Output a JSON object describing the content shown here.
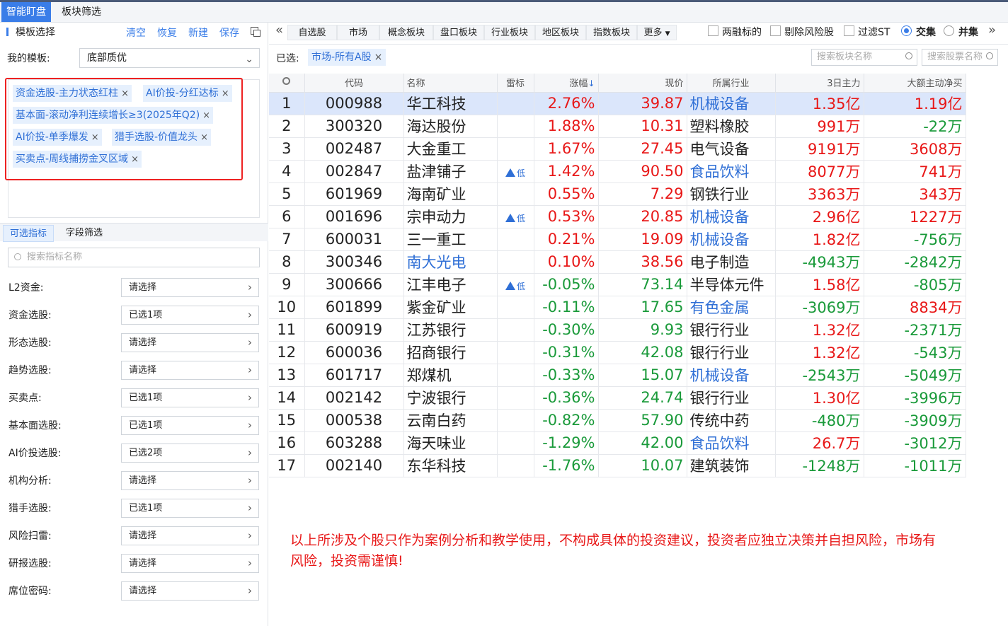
{
  "topbar": {
    "tabs": [
      "智能盯盘",
      "板块筛选"
    ]
  },
  "left": {
    "title": "模板选择",
    "actions": [
      "清空",
      "恢复",
      "新建",
      "保存"
    ],
    "my_template_label": "我的模板:",
    "my_template_value": "底部质优",
    "tags": [
      "资金选股-主力状态红柱",
      "AI价投-分红达标",
      "基本面-滚动净利连续增长≥3(2025年Q2)",
      "AI价投-单季爆发",
      "猎手选股-价值龙头",
      "买卖点-周线捕捞金叉区域"
    ],
    "subtabs": [
      "可选指标",
      "字段筛选"
    ],
    "search_placeholder": "搜索指标名称",
    "filters": [
      {
        "label": "L2资金:",
        "value": "请选择"
      },
      {
        "label": "资金选股:",
        "value": "已选1项"
      },
      {
        "label": "形态选股:",
        "value": "请选择"
      },
      {
        "label": "趋势选股:",
        "value": "请选择"
      },
      {
        "label": "买卖点:",
        "value": "已选1项"
      },
      {
        "label": "基本面选股:",
        "value": "已选1项"
      },
      {
        "label": "AI价投选股:",
        "value": "已选2项"
      },
      {
        "label": "机构分析:",
        "value": "请选择"
      },
      {
        "label": "猎手选股:",
        "value": "已选1项"
      },
      {
        "label": "风险扫雷:",
        "value": "请选择"
      },
      {
        "label": "研报选股:",
        "value": "请选择"
      },
      {
        "label": "席位密码:",
        "value": "请选择"
      }
    ]
  },
  "right": {
    "nav": [
      "自选股",
      "市场",
      "概念板块",
      "盘口板块",
      "行业板块",
      "地区板块",
      "指数板块",
      "更多"
    ],
    "options": [
      "两融标的",
      "剔除风险股",
      "过滤ST"
    ],
    "radios": [
      "交集",
      "并集"
    ],
    "selected_label": "已选:",
    "selected_chip": "市场-所有A股",
    "search_sector_placeholder": "搜索板块名称",
    "search_stock_placeholder": "搜索股票名称",
    "columns": [
      "代码",
      "名称",
      "雷标",
      "涨幅",
      "现价",
      "所属行业",
      "3日主力",
      "大额主动净买"
    ],
    "risk_label": "低",
    "rows": [
      {
        "n": "1",
        "code": "000988",
        "name": "华工科技",
        "risk": false,
        "chg": "2.76%",
        "price": "39.87",
        "ind": "机械设备",
        "indBlue": true,
        "nameBlue": false,
        "m3": "1.35亿",
        "big": "1.19亿"
      },
      {
        "n": "2",
        "code": "300320",
        "name": "海达股份",
        "risk": false,
        "chg": "1.88%",
        "price": "10.31",
        "ind": "塑料橡胶",
        "indBlue": false,
        "nameBlue": false,
        "m3": "991万",
        "big": "-22万"
      },
      {
        "n": "3",
        "code": "002487",
        "name": "大金重工",
        "risk": false,
        "chg": "1.67%",
        "price": "27.45",
        "ind": "电气设备",
        "indBlue": false,
        "nameBlue": false,
        "m3": "9191万",
        "big": "3608万"
      },
      {
        "n": "4",
        "code": "002847",
        "name": "盐津铺子",
        "risk": true,
        "chg": "1.42%",
        "price": "90.50",
        "ind": "食品饮料",
        "indBlue": true,
        "nameBlue": false,
        "m3": "8077万",
        "big": "741万"
      },
      {
        "n": "5",
        "code": "601969",
        "name": "海南矿业",
        "risk": false,
        "chg": "0.55%",
        "price": "7.29",
        "ind": "钢铁行业",
        "indBlue": false,
        "nameBlue": false,
        "m3": "3363万",
        "big": "343万"
      },
      {
        "n": "6",
        "code": "001696",
        "name": "宗申动力",
        "risk": true,
        "chg": "0.53%",
        "price": "20.85",
        "ind": "机械设备",
        "indBlue": true,
        "nameBlue": false,
        "m3": "2.96亿",
        "big": "1227万"
      },
      {
        "n": "7",
        "code": "600031",
        "name": "三一重工",
        "risk": false,
        "chg": "0.21%",
        "price": "19.09",
        "ind": "机械设备",
        "indBlue": true,
        "nameBlue": false,
        "m3": "1.82亿",
        "big": "-756万"
      },
      {
        "n": "8",
        "code": "300346",
        "name": "南大光电",
        "risk": false,
        "chg": "0.10%",
        "price": "38.56",
        "ind": "电子制造",
        "indBlue": false,
        "nameBlue": true,
        "m3": "-4943万",
        "big": "-2842万"
      },
      {
        "n": "9",
        "code": "300666",
        "name": "江丰电子",
        "risk": true,
        "chg": "-0.05%",
        "price": "73.14",
        "ind": "半导体元件",
        "indBlue": false,
        "nameBlue": false,
        "m3": "1.58亿",
        "big": "-805万"
      },
      {
        "n": "10",
        "code": "601899",
        "name": "紫金矿业",
        "risk": false,
        "chg": "-0.11%",
        "price": "17.65",
        "ind": "有色金属",
        "indBlue": true,
        "nameBlue": false,
        "m3": "-3069万",
        "big": "8834万"
      },
      {
        "n": "11",
        "code": "600919",
        "name": "江苏银行",
        "risk": false,
        "chg": "-0.30%",
        "price": "9.93",
        "ind": "银行行业",
        "indBlue": false,
        "nameBlue": false,
        "m3": "1.32亿",
        "big": "-2371万"
      },
      {
        "n": "12",
        "code": "600036",
        "name": "招商银行",
        "risk": false,
        "chg": "-0.31%",
        "price": "42.08",
        "ind": "银行行业",
        "indBlue": false,
        "nameBlue": false,
        "m3": "1.32亿",
        "big": "-543万"
      },
      {
        "n": "13",
        "code": "601717",
        "name": "郑煤机",
        "risk": false,
        "chg": "-0.33%",
        "price": "15.07",
        "ind": "机械设备",
        "indBlue": true,
        "nameBlue": false,
        "m3": "-2543万",
        "big": "-5049万"
      },
      {
        "n": "14",
        "code": "002142",
        "name": "宁波银行",
        "risk": false,
        "chg": "-0.36%",
        "price": "24.74",
        "ind": "银行行业",
        "indBlue": false,
        "nameBlue": false,
        "m3": "1.30亿",
        "big": "-3996万"
      },
      {
        "n": "15",
        "code": "000538",
        "name": "云南白药",
        "risk": false,
        "chg": "-0.82%",
        "price": "57.90",
        "ind": "传统中药",
        "indBlue": false,
        "nameBlue": false,
        "m3": "-480万",
        "big": "-3909万"
      },
      {
        "n": "16",
        "code": "603288",
        "name": "海天味业",
        "risk": false,
        "chg": "-1.29%",
        "price": "42.00",
        "ind": "食品饮料",
        "indBlue": true,
        "nameBlue": false,
        "m3": "26.7万",
        "big": "-3012万"
      },
      {
        "n": "17",
        "code": "002140",
        "name": "东华科技",
        "risk": false,
        "chg": "-1.76%",
        "price": "10.07",
        "ind": "建筑装饰",
        "indBlue": false,
        "nameBlue": false,
        "m3": "-1248万",
        "big": "-1011万"
      }
    ],
    "disclaimer": "以上所涉及个股只作为案例分析和教学使用，不构成具体的投资建议，投资者应独立决策并自担风险，市场有风险，投资需谨慎!"
  },
  "colors": {
    "accent": "#3a7de8",
    "up": "#e81818",
    "down": "#1a9a3a",
    "highlight_row": "#dbe6fb",
    "tag_border": "#e22"
  }
}
